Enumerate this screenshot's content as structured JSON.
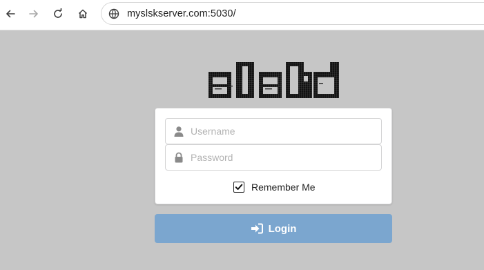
{
  "browser": {
    "back_icon": "arrow-left-icon",
    "forward_icon": "arrow-right-icon",
    "reload_icon": "reload-icon",
    "home_icon": "home-icon",
    "site_info_icon": "globe-icon",
    "url": "myslskserver.com:5030/"
  },
  "logo": {
    "name": "slskd",
    "style": "ascii-art"
  },
  "login_form": {
    "username": {
      "icon": "user-icon",
      "placeholder": "Username",
      "value": ""
    },
    "password": {
      "icon": "lock-icon",
      "placeholder": "Password",
      "value": ""
    },
    "remember_me": {
      "label": "Remember Me",
      "checked": true
    },
    "submit": {
      "icon": "sign-in-icon",
      "label": "Login"
    }
  },
  "colors": {
    "page_background": "#c6c6c6",
    "button_background": "#7ba6cf",
    "button_text": "#ffffff"
  }
}
